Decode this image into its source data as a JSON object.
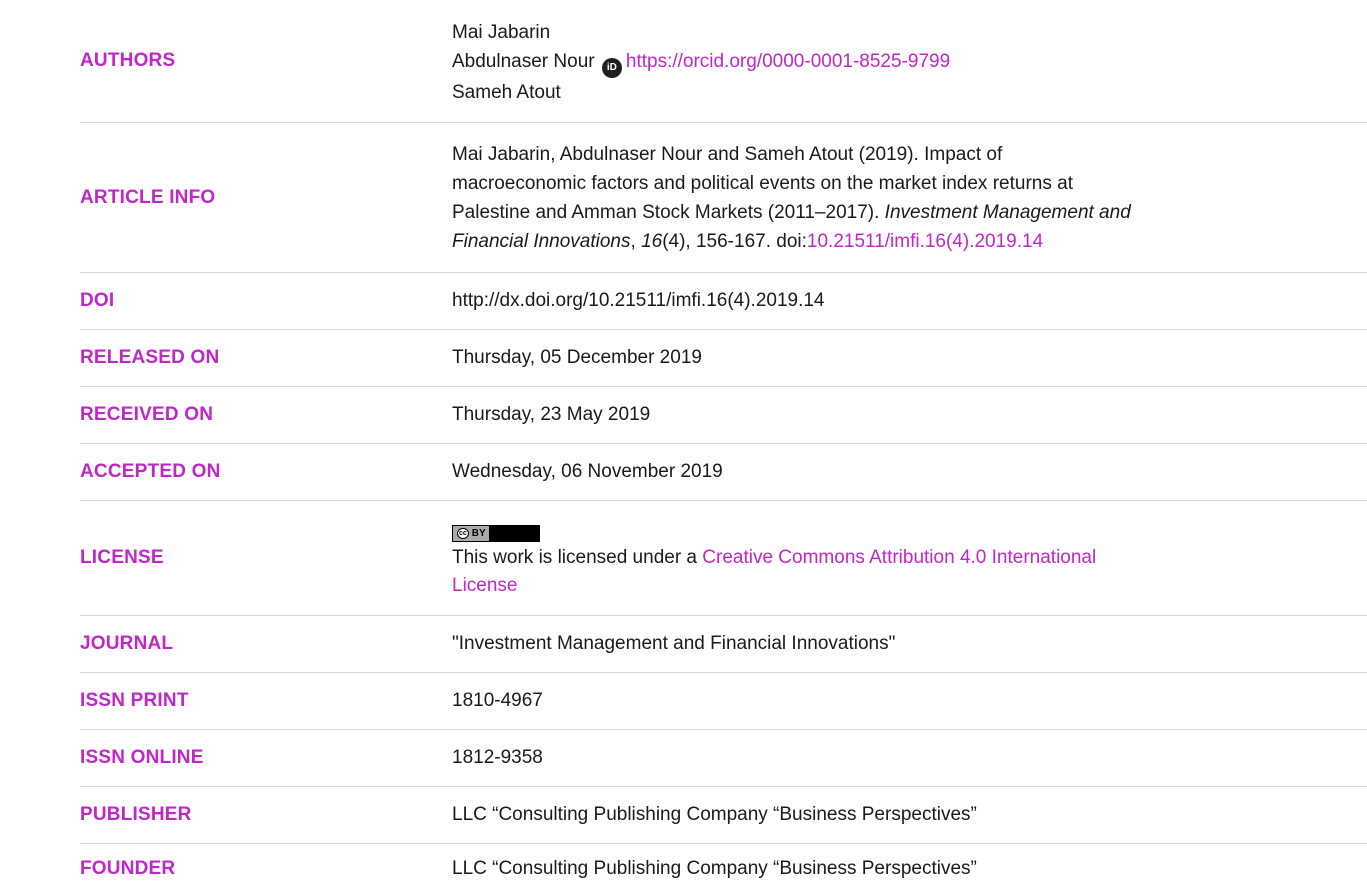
{
  "authors": {
    "label": "AUTHORS",
    "names": [
      "Mai Jabarin",
      "Abdulnaser Nour",
      "Sameh Atout"
    ],
    "orcid_url": "https://orcid.org/0000-0001-8525-9799",
    "orcid_icon": "orcid-icon"
  },
  "article_info": {
    "label": "ARTICLE INFO",
    "line1": "Mai Jabarin, Abdulnaser Nour and Sameh Atout (2019). Impact of",
    "line2": "macroeconomic factors and political events on the market index returns at",
    "line3_pre": "Palestine and Amman Stock Markets (2011–2017). ",
    "journal_italic": "Investment Management and",
    "journal_italic_2": "Financial Innovations",
    "sep1": ", ",
    "volume": "16",
    "issue_pages": "(4), 156-167. doi:",
    "doi_link": "10.21511/imfi.16(4).2019.14"
  },
  "doi": {
    "label": "DOI",
    "value": "http://dx.doi.org/10.21511/imfi.16(4).2019.14"
  },
  "released_on": {
    "label": "RELEASED ON",
    "value": "Thursday, 05 December 2019"
  },
  "received_on": {
    "label": "RECEIVED ON",
    "value": "Thursday, 23 May 2019"
  },
  "accepted_on": {
    "label": "ACCEPTED ON",
    "value": "Wednesday, 06 November 2019"
  },
  "license": {
    "label": "LICENSE",
    "badge_cc": "cc",
    "badge_by": "BY",
    "text_pre": "This work is licensed under a ",
    "link_1": "Creative Commons Attribution 4.0 International",
    "link_2": "License"
  },
  "journal": {
    "label": "JOURNAL",
    "value": "\"Investment Management and Financial Innovations\""
  },
  "issn_print": {
    "label": "ISSN PRINT",
    "value": "1810-4967"
  },
  "issn_online": {
    "label": "ISSN ONLINE",
    "value": "1812-9358"
  },
  "publisher": {
    "label": "PUBLISHER",
    "value": "LLC “Consulting Publishing Company “Business Perspectives”"
  },
  "founder": {
    "label": "FOUNDER",
    "value": "LLC “Consulting Publishing Company “Business Perspectives”"
  },
  "colors": {
    "accent": "#c026c8",
    "text": "#1a1a1a",
    "divider": "#d6d6d6"
  }
}
